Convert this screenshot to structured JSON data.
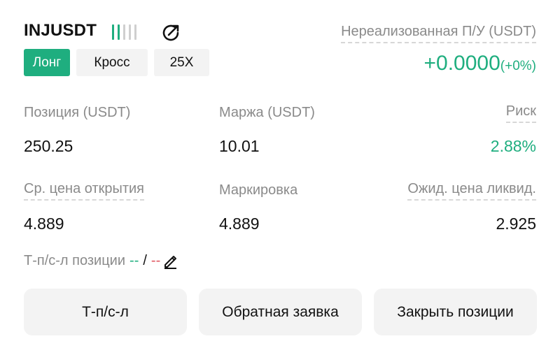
{
  "header": {
    "symbol": "INJUSDT",
    "unrealized_label": "Нереализованная П/У (USDT)",
    "unrealized_value": "+0.0000",
    "unrealized_pct": "(+0%)"
  },
  "tags": {
    "side": "Лонг",
    "margin_mode": "Кросс",
    "leverage": "25X"
  },
  "stats": {
    "position_label": "Позиция (USDT)",
    "position_value": "250.25",
    "margin_label": "Маржа (USDT)",
    "margin_value": "10.01",
    "risk_label": "Риск",
    "risk_value": "2.88%",
    "entry_label": "Ср. цена открытия",
    "entry_value": "4.889",
    "mark_label": "Маркировка",
    "mark_value": "4.889",
    "liq_label": "Ожид. цена ликвид.",
    "liq_value": "2.925"
  },
  "tpsl": {
    "label": "Т-п/с-л позиции",
    "tp": "--",
    "separator": "/",
    "sl": "--"
  },
  "buttons": {
    "tpsl": "Т-п/с-л",
    "reverse": "Обратная заявка",
    "close": "Закрыть позиции"
  },
  "colors": {
    "accent_green": "#1fae7f",
    "loss_red": "#e0565f"
  },
  "signal_bars": {
    "active": 2,
    "total": 5
  }
}
